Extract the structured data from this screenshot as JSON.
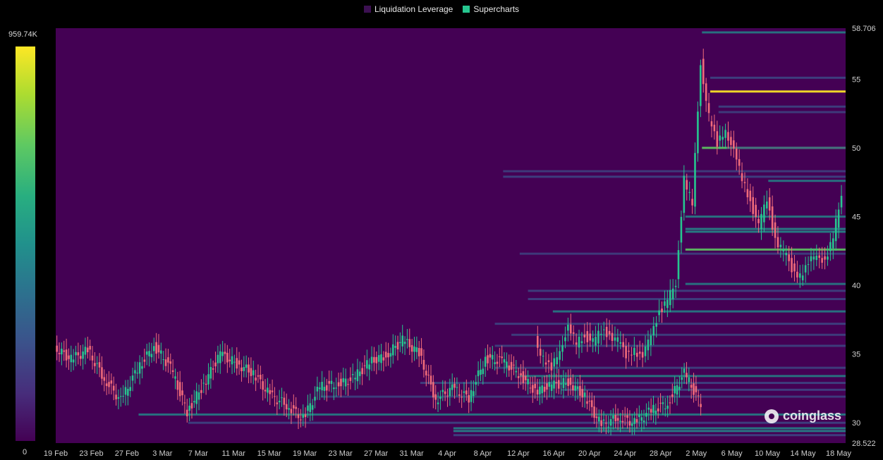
{
  "legend": {
    "items": [
      {
        "label": "Liquidation Leverage",
        "color": "#3c1052"
      },
      {
        "label": "Supercharts",
        "color": "#26c68f"
      }
    ]
  },
  "colorbar": {
    "max_label": "959.74K",
    "min_label": "0"
  },
  "watermark": {
    "text": "coinglass",
    "icon": "coinglass-logo-icon"
  },
  "colors": {
    "background": "#440154",
    "up_candle": "#26c68f",
    "down_candle": "#f06b7a",
    "heat_low": "#3b528b",
    "heat_mid": "#21918c",
    "heat_high": "#5ec962",
    "heat_peak": "#fde725"
  },
  "chart_data": {
    "type": "heatmap",
    "title": "",
    "xlabel": "",
    "ylabel": "",
    "ylim": [
      28.522,
      58.706
    ],
    "y_tick_labels": [
      "58.706",
      "55",
      "50",
      "45",
      "40",
      "35",
      "30",
      "28.522"
    ],
    "y_ticks": [
      58.706,
      55,
      50,
      45,
      40,
      35,
      30,
      28.522
    ],
    "x_tick_labels": [
      "19 Feb",
      "23 Feb",
      "27 Feb",
      "3 Mar",
      "7 Mar",
      "11 Mar",
      "15 Mar",
      "19 Mar",
      "23 Mar",
      "27 Mar",
      "31 Mar",
      "4 Apr",
      "8 Apr",
      "12 Apr",
      "16 Apr",
      "20 Apr",
      "24 Apr",
      "28 Apr",
      "2 May",
      "6 May",
      "10 May",
      "14 May",
      "18 May"
    ],
    "day_range": [
      0,
      95
    ],
    "price_series": [
      [
        0,
        35.5
      ],
      [
        2,
        34.6
      ],
      [
        4,
        35.3
      ],
      [
        6,
        33.2
      ],
      [
        8,
        31.6
      ],
      [
        10,
        33.9
      ],
      [
        12,
        35.6
      ],
      [
        14,
        34.0
      ],
      [
        16,
        30.8
      ],
      [
        18,
        32.8
      ],
      [
        20,
        35.0
      ],
      [
        22,
        34.3
      ],
      [
        24,
        33.6
      ],
      [
        26,
        32.0
      ],
      [
        28,
        31.3
      ],
      [
        30,
        30.3
      ],
      [
        32,
        32.6
      ],
      [
        34,
        32.8
      ],
      [
        36,
        33.2
      ],
      [
        38,
        34.4
      ],
      [
        40,
        34.9
      ],
      [
        42,
        36.0
      ],
      [
        44,
        35.1
      ],
      [
        46,
        31.7
      ],
      [
        48,
        32.5
      ],
      [
        50,
        31.8
      ],
      [
        52,
        34.7
      ],
      [
        54,
        34.5
      ],
      [
        56,
        33.6
      ],
      [
        58,
        32.3
      ],
      [
        60,
        32.7
      ],
      [
        62,
        33.0
      ],
      [
        64,
        31.9
      ],
      [
        66,
        29.8
      ],
      [
        68,
        30.4
      ],
      [
        70,
        30.0
      ],
      [
        72,
        30.9
      ],
      [
        74,
        31.4
      ],
      [
        76,
        33.6
      ],
      [
        78,
        31.4
      ],
      [
        80,
        40.0
      ],
      [
        82,
        46.8
      ],
      [
        84,
        45.2
      ],
      [
        86,
        43.0
      ],
      [
        88,
        41.5
      ],
      [
        90,
        39.7
      ],
      [
        92,
        38.3
      ],
      [
        94,
        36.2
      ]
    ],
    "price_series_2": [
      [
        58,
        36.2
      ],
      [
        59,
        34.6
      ],
      [
        60,
        33.8
      ],
      [
        61,
        35.5
      ],
      [
        62,
        36.8
      ],
      [
        63,
        35.8
      ],
      [
        64,
        36.4
      ],
      [
        65,
        35.8
      ],
      [
        66,
        36.7
      ],
      [
        67,
        36.5
      ],
      [
        68,
        35.9
      ],
      [
        69,
        35.0
      ],
      [
        70,
        35.4
      ],
      [
        71,
        34.5
      ],
      [
        72,
        36.7
      ],
      [
        73,
        38.0
      ],
      [
        74,
        38.8
      ],
      [
        75,
        40.3
      ],
      [
        76,
        47.7
      ],
      [
        77,
        45.8
      ],
      [
        78,
        56.3
      ],
      [
        79,
        52.2
      ],
      [
        80,
        50.2
      ],
      [
        81,
        51.5
      ],
      [
        82,
        49.6
      ],
      [
        83,
        47.8
      ],
      [
        84,
        46.2
      ],
      [
        85,
        44.2
      ],
      [
        86,
        46.4
      ],
      [
        87,
        43.4
      ],
      [
        88,
        42.4
      ],
      [
        89,
        41.3
      ],
      [
        90,
        40.7
      ],
      [
        91,
        41.4
      ],
      [
        92,
        42.5
      ],
      [
        93,
        41.6
      ],
      [
        94,
        43.4
      ],
      [
        95,
        46.8
      ]
    ],
    "liquidation_levels": [
      {
        "price": 58.4,
        "start_day": 78,
        "intensity": 0.55
      },
      {
        "price": 55.1,
        "start_day": 79,
        "intensity": 0.5
      },
      {
        "price": 54.1,
        "start_day": 79,
        "intensity": 0.95
      },
      {
        "price": 53.0,
        "start_day": 80,
        "intensity": 0.45
      },
      {
        "price": 52.6,
        "start_day": 80,
        "intensity": 0.35
      },
      {
        "price": 50.0,
        "start_day": 78,
        "intensity": 0.9
      },
      {
        "price": 50.0,
        "start_day": 81,
        "intensity": 0.35
      },
      {
        "price": 48.3,
        "start_day": 54,
        "intensity": 0.35
      },
      {
        "price": 47.9,
        "start_day": 54,
        "intensity": 0.5
      },
      {
        "price": 47.6,
        "start_day": 86,
        "intensity": 0.55
      },
      {
        "price": 45.0,
        "start_day": 76,
        "intensity": 0.55
      },
      {
        "price": 44.1,
        "start_day": 76,
        "intensity": 0.65
      },
      {
        "price": 43.9,
        "start_day": 76,
        "intensity": 0.7
      },
      {
        "price": 42.6,
        "start_day": 76,
        "intensity": 0.85
      },
      {
        "price": 42.3,
        "start_day": 56,
        "intensity": 0.35
      },
      {
        "price": 40.1,
        "start_day": 76,
        "intensity": 0.55
      },
      {
        "price": 39.6,
        "start_day": 57,
        "intensity": 0.45
      },
      {
        "price": 39.0,
        "start_day": 57,
        "intensity": 0.5
      },
      {
        "price": 38.1,
        "start_day": 60,
        "intensity": 0.55
      },
      {
        "price": 37.2,
        "start_day": 53,
        "intensity": 0.5
      },
      {
        "price": 36.4,
        "start_day": 55,
        "intensity": 0.45
      },
      {
        "price": 35.6,
        "start_day": 53,
        "intensity": 0.45
      },
      {
        "price": 34.0,
        "start_day": 53,
        "intensity": 0.45
      },
      {
        "price": 33.4,
        "start_day": 56,
        "intensity": 0.55
      },
      {
        "price": 32.9,
        "start_day": 44,
        "intensity": 0.5
      },
      {
        "price": 32.4,
        "start_day": 61,
        "intensity": 0.5
      },
      {
        "price": 31.9,
        "start_day": 32,
        "intensity": 0.4
      },
      {
        "price": 30.6,
        "start_day": 10,
        "intensity": 0.55
      },
      {
        "price": 30.0,
        "start_day": 16,
        "intensity": 0.5
      },
      {
        "price": 29.6,
        "start_day": 48,
        "intensity": 0.6
      },
      {
        "price": 29.4,
        "start_day": 48,
        "intensity": 0.65
      },
      {
        "price": 29.1,
        "start_day": 48,
        "intensity": 0.5
      }
    ],
    "colorbar_range": [
      0,
      959740
    ]
  }
}
